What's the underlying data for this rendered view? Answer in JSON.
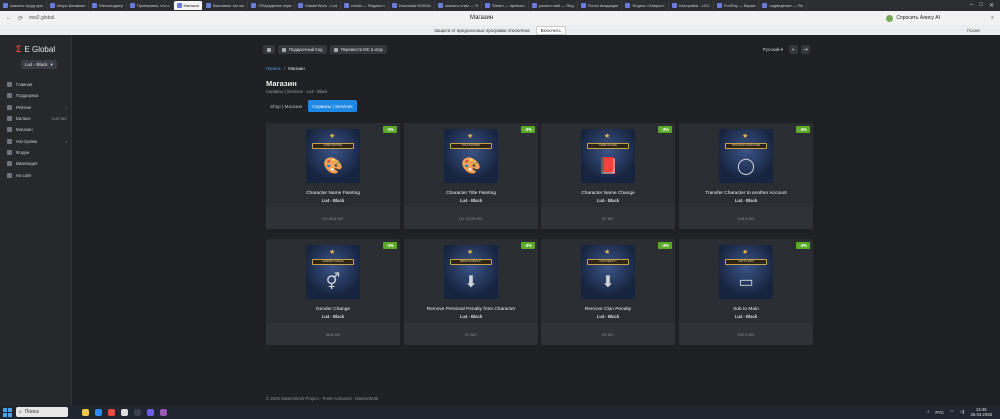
{
  "browser": {
    "tabs": [
      {
        "label": "скачать lopgq при"
      },
      {
        "label": "Игорь Бигавкин"
      },
      {
        "label": "Мессенджер"
      },
      {
        "label": "Проверяем, что о"
      },
      {
        "label": "Магазин",
        "active": true
      },
      {
        "label": "Выставил тох мо"
      },
      {
        "label": "Обсуждение серв"
      },
      {
        "label": "MasterWork - Lu4"
      },
      {
        "label": "nvidia — Яндекс:н"
      },
      {
        "label": "Download NVIDIA"
      },
      {
        "label": "скачать стим — Я"
      },
      {
        "label": "Steam — превосх"
      },
      {
        "label": "yandex mail — Янд"
      },
      {
        "label": "Почта входящие"
      },
      {
        "label": "Яндекс «Запрос»"
      },
      {
        "label": "Настройки - LDC"
      },
      {
        "label": "FunPay — биржа"
      },
      {
        "label": "подведение — Ян"
      }
    ],
    "url": "mw2.global",
    "page_title": "Магазин",
    "account_label": "Спросить Алису AI",
    "protection_text": "Защита от вредоносных программ отключена",
    "protection_button": "Включить",
    "later_label": "Позже"
  },
  "sidebar": {
    "logo_text": "E Global",
    "character_select": "Lu4 - Black",
    "items": [
      {
        "label": "Главная",
        "icon": "home-icon"
      },
      {
        "label": "Поддержка",
        "icon": "support-icon"
      },
      {
        "label": "Рейтинг",
        "icon": "rating-icon",
        "extra": "›"
      },
      {
        "label": "Баланс",
        "icon": "wallet-icon",
        "extra": "0,00 МС"
      },
      {
        "label": "Магазин",
        "icon": "shop-icon"
      },
      {
        "label": "Настройки",
        "icon": "gear-icon",
        "extra": "›"
      },
      {
        "label": "Форум",
        "icon": "forum-icon"
      },
      {
        "label": "Википедия",
        "icon": "wiki-icon"
      },
      {
        "label": "На сайт",
        "icon": "site-icon"
      }
    ]
  },
  "topbar": {
    "gift_code": "Подарочный Код",
    "transfer": "Перевести МС в игру",
    "language": "Русский ▾"
  },
  "breadcrumb": {
    "root": "Панель",
    "current": "Магазин"
  },
  "page": {
    "title": "Магазин",
    "subtitle": "Сервисы | Services · Lu4 - Black",
    "tabs": [
      "Shop | Магазин",
      "Сервисы | Services"
    ],
    "active_tab": 1
  },
  "products": [
    {
      "name": "Character Name Painting",
      "server": "Lu4 - Black",
      "price": "От 48,5 МС",
      "discount": "-3%",
      "plate": "NAME PAINTING",
      "glyph": "🎨"
    },
    {
      "name": "Character Title Painting",
      "server": "Lu4 - Black",
      "price": "От 24,25 МС",
      "discount": "-3%",
      "plate": "TITLE PAINTING",
      "glyph": "🎨"
    },
    {
      "name": "Character Name Change",
      "server": "Lu4 - Black",
      "price": "97 МС",
      "discount": "-3%",
      "plate": "NAME CHANGE",
      "glyph": "📕"
    },
    {
      "name": "Transfer Character to another Account",
      "server": "Lu4 - Black",
      "price": "145,5 МС",
      "discount": "-3%",
      "plate": "TRANSFER CHARACTER",
      "glyph": "◯"
    },
    {
      "name": "Gender Change",
      "server": "Lu4 - Black",
      "price": "38,8 МС",
      "discount": "-3%",
      "plate": "GENDER CHANGE",
      "glyph": "⚥"
    },
    {
      "name": "Remove Personal Penalty from Character",
      "server": "Lu4 - Black",
      "price": "97 МС",
      "discount": "-3%",
      "plate": "REMOVE PENALTY",
      "glyph": "⬇"
    },
    {
      "name": "Remove Clan Penalty",
      "server": "Lu4 - Black",
      "price": "29 МС",
      "discount": "-3%",
      "plate": "CLAN PENALTY",
      "glyph": "⬇"
    },
    {
      "name": "Sub to Main",
      "server": "Lu4 - Black",
      "price": "242,5 МС",
      "discount": "-3%",
      "plate": "SUB TO MAIN",
      "glyph": "▭"
    }
  ],
  "footer": "© 2026 MasterWork Project · Point-Activated · MasterWork",
  "taskbar": {
    "search_placeholder": "Поиск",
    "lang": "РУС",
    "time": "13:46",
    "date": "26.04.2026"
  }
}
